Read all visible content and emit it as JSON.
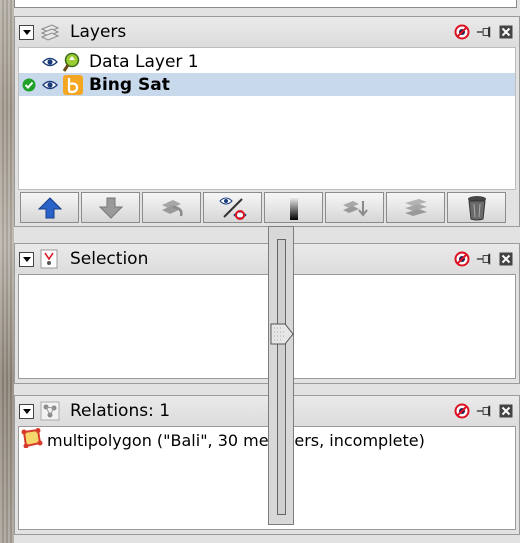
{
  "colors": {
    "panel_bg": "#e2e2e2",
    "selected_row": "#c9d9ec",
    "arrow_blue": "#2a63c8",
    "check_green": "#1fa12a",
    "bing_orange": "#f5a623",
    "relation_icon": "#d83b2b"
  },
  "layers_panel": {
    "title": "Layers",
    "icon": "layers-icon",
    "rows": [
      {
        "name": "Data Layer 1",
        "icon": "data-layer-icon",
        "visible": true,
        "active": false,
        "bold": false
      },
      {
        "name": "Bing Sat",
        "icon": "bing-icon",
        "visible": true,
        "active": true,
        "bold": true
      }
    ],
    "buttons": [
      {
        "name": "move-up-button",
        "icon": "arrow-up-icon",
        "enabled": true
      },
      {
        "name": "move-down-button",
        "icon": "arrow-down-icon",
        "enabled": true
      },
      {
        "name": "activate-button",
        "icon": "activate-icon",
        "enabled": false
      },
      {
        "name": "show-hide-button",
        "icon": "show-hide-icon",
        "enabled": true
      },
      {
        "name": "opacity-button",
        "icon": "opacity-icon",
        "enabled": true
      },
      {
        "name": "merge-button",
        "icon": "merge-icon",
        "enabled": false
      },
      {
        "name": "duplicate-button",
        "icon": "duplicate-icon",
        "enabled": false
      },
      {
        "name": "delete-button",
        "icon": "trash-icon",
        "enabled": true
      }
    ]
  },
  "selection_panel": {
    "title": "Selection",
    "icon": "selection-icon"
  },
  "relations_panel": {
    "title": "Relations: 1",
    "icon": "relations-icon",
    "items": [
      {
        "text": "multipolygon (\"Bali\", 30 members, incomplete)",
        "icon": "multipolygon-icon"
      }
    ]
  },
  "opacity_slider": {
    "level": 0.67
  }
}
